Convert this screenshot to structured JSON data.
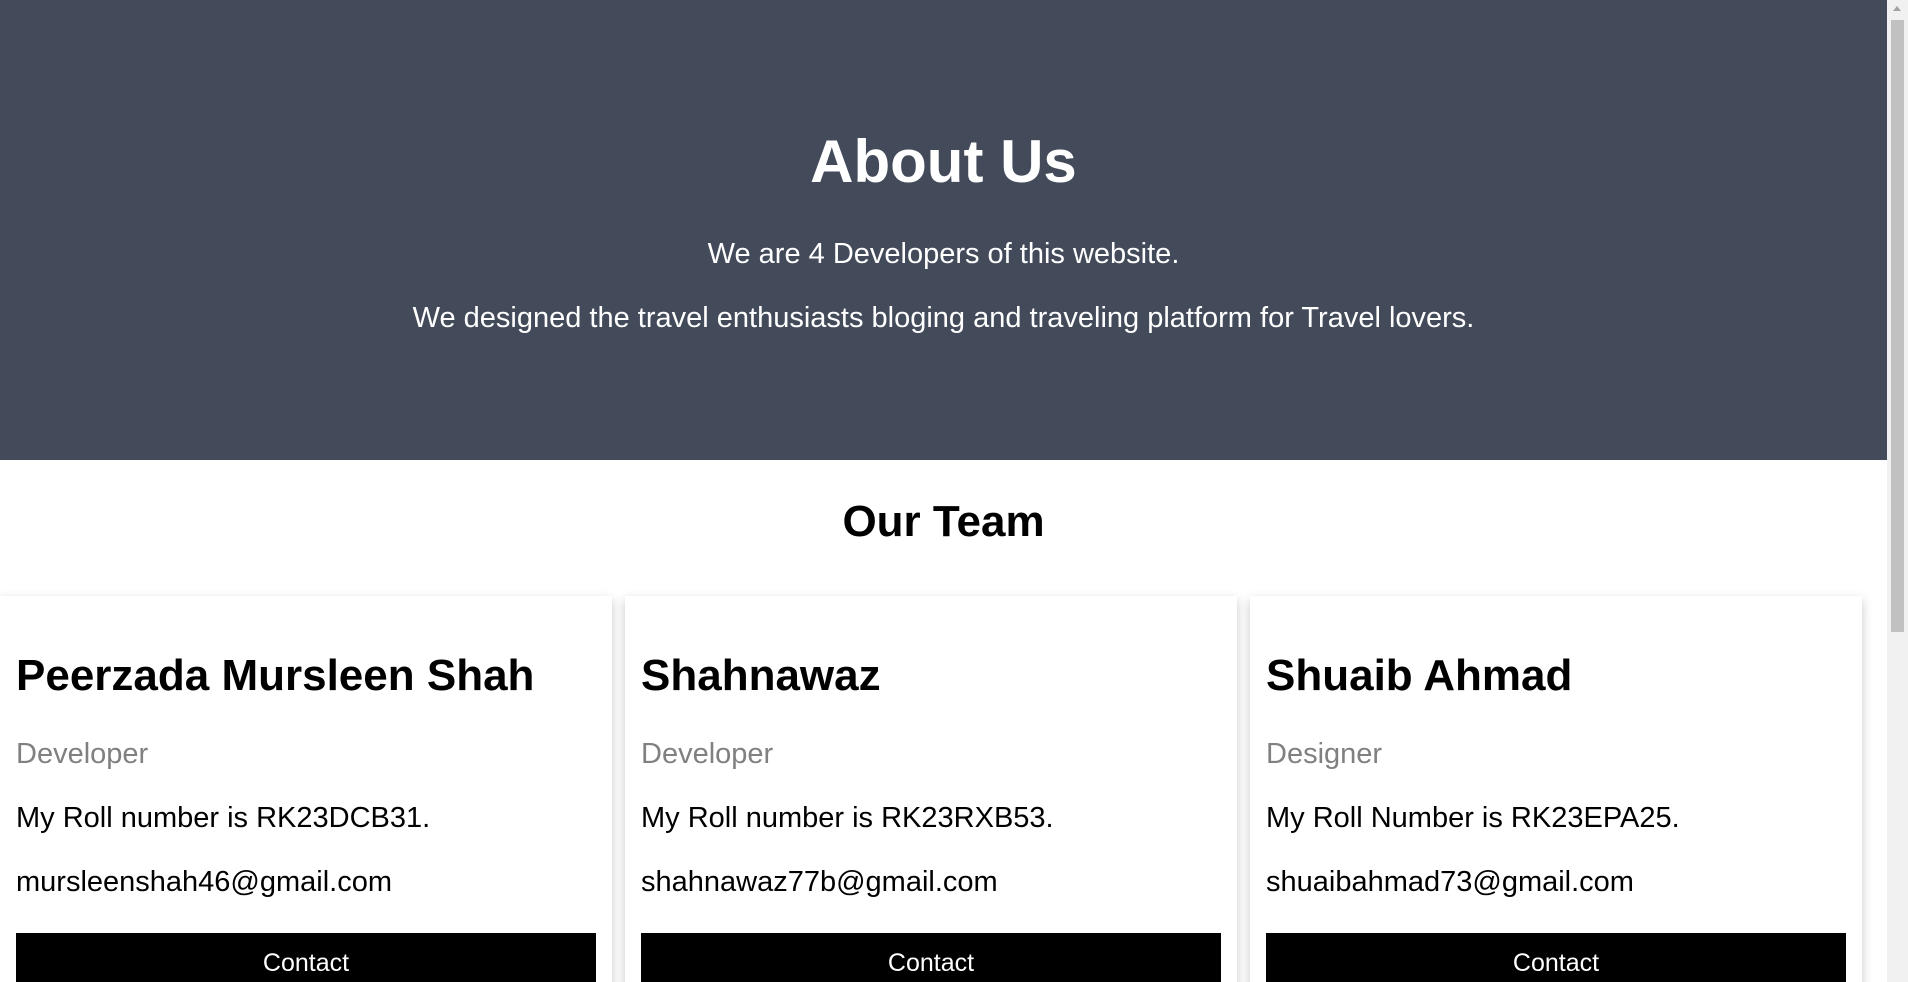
{
  "hero": {
    "title": "About Us",
    "paragraph_1": "We are 4 Developers of this website.",
    "paragraph_2": "We designed the travel enthusiasts bloging and traveling platform for Travel lovers."
  },
  "team": {
    "heading": "Our Team",
    "members": [
      {
        "name": "Peerzada Mursleen Shah",
        "title": "Developer",
        "roll": "My Roll number is RK23DCB31.",
        "email": "mursleenshah46@gmail.com",
        "button": "Contact"
      },
      {
        "name": "Shahnawaz",
        "title": "Developer",
        "roll": "My Roll number is RK23RXB53.",
        "email": "shahnawaz77b@gmail.com",
        "button": "Contact"
      },
      {
        "name": "Shuaib Ahmad",
        "title": "Designer",
        "roll": "My Roll Number is RK23EPA25.",
        "email": "shuaibahmad73@gmail.com",
        "button": "Contact"
      }
    ]
  },
  "colors": {
    "hero_background": "#434a5a",
    "button_background": "#000000",
    "title_text": "#808080"
  }
}
